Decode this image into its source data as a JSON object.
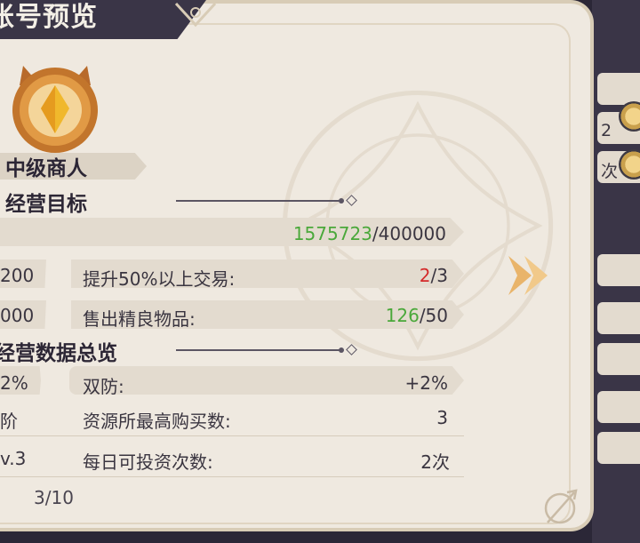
{
  "title": "账号预览",
  "rank": {
    "name": "中级商人"
  },
  "sections": {
    "goals": "经营目标",
    "overview": "经营数据总览"
  },
  "goals": {
    "progress": {
      "current": "1575723",
      "total": "/400000"
    },
    "row2": {
      "left_value": "200",
      "label": "提升50%以上交易:",
      "current": "2",
      "total": "/3"
    },
    "row3": {
      "left_value": "000",
      "label": "售出精良物品:",
      "current": "126",
      "total": "/50"
    }
  },
  "overview": {
    "row1": {
      "left_value": "2%",
      "label": "双防:",
      "value": "+2%"
    },
    "row2": {
      "left_value": "阶",
      "label": "资源所最高购买数:",
      "value": "3"
    },
    "row3": {
      "left_value": "v.3",
      "label": "每日可投资次数:",
      "value": "2次"
    }
  },
  "page_indicator": "3/10",
  "side_peek": {
    "num": "2",
    "text": "次"
  },
  "colors": {
    "accent_green": "#4aa83a",
    "accent_red": "#d42a2a",
    "dark": "#3a3547",
    "panel": "#efe9e0"
  },
  "icons": {
    "next": "chevron-right-icon",
    "medal": "rank-medal-icon"
  }
}
